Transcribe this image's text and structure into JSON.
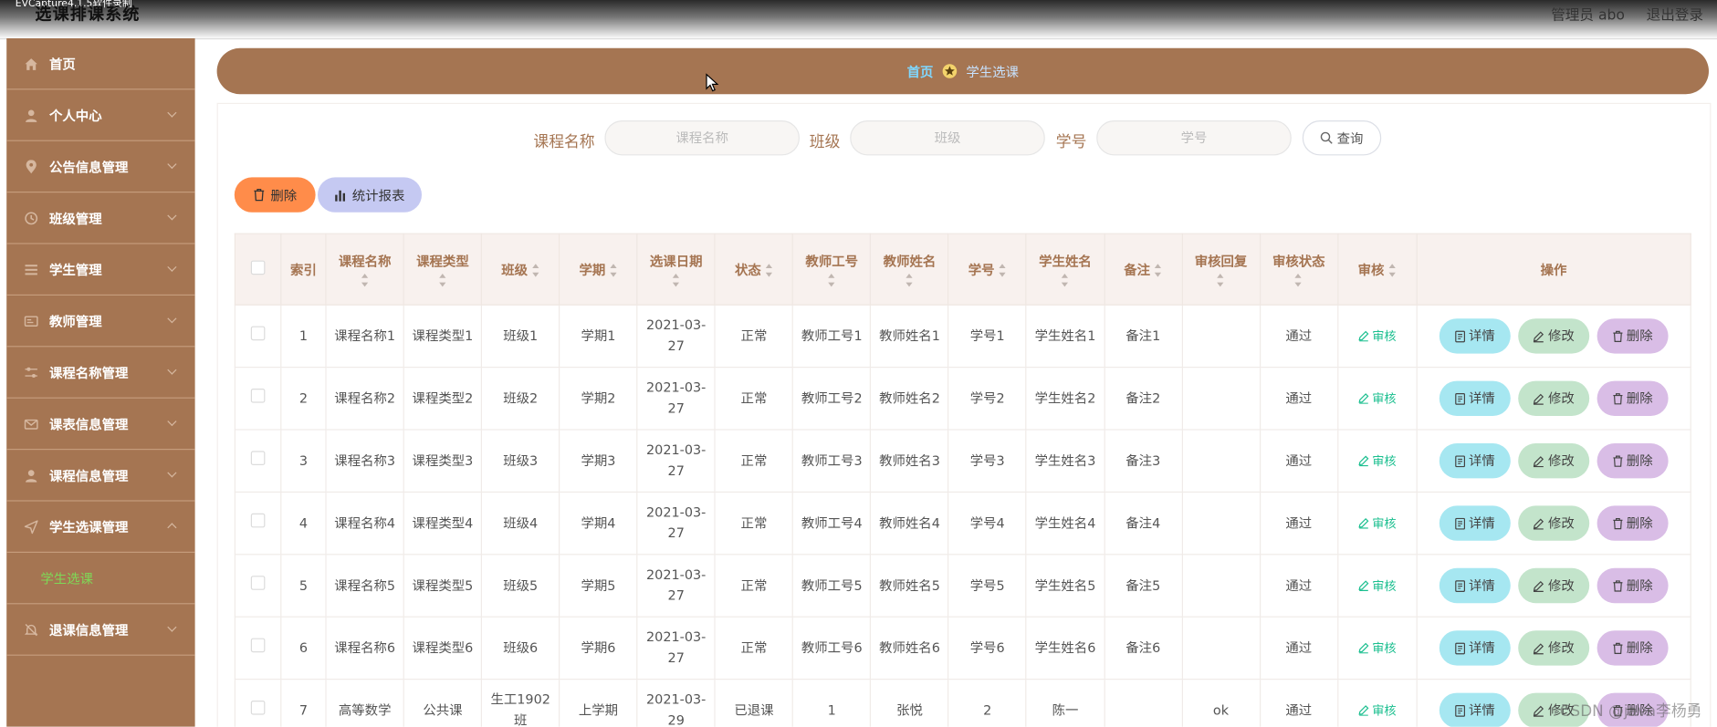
{
  "capture_label": "EVCapture4.1.5软件录制",
  "app": {
    "title": "选课排课系统",
    "admin": "管理员 abo",
    "logout": "退出登录"
  },
  "sidebar": {
    "items": [
      {
        "label": "首页",
        "icon": "home-icon",
        "expandable": false
      },
      {
        "label": "个人中心",
        "icon": "user-icon",
        "expandable": true
      },
      {
        "label": "公告信息管理",
        "icon": "location-icon",
        "expandable": true
      },
      {
        "label": "班级管理",
        "icon": "clock-icon",
        "expandable": true
      },
      {
        "label": "学生管理",
        "icon": "list-icon",
        "expandable": true
      },
      {
        "label": "教师管理",
        "icon": "card-icon",
        "expandable": true
      },
      {
        "label": "课程名称管理",
        "icon": "sliders-icon",
        "expandable": true
      },
      {
        "label": "课表信息管理",
        "icon": "mail-icon",
        "expandable": true
      },
      {
        "label": "课程信息管理",
        "icon": "user-icon",
        "expandable": true
      },
      {
        "label": "学生选课管理",
        "icon": "send-icon",
        "expandable": true,
        "expanded": true
      },
      {
        "label": "退课信息管理",
        "icon": "bell-off-icon",
        "expandable": true
      }
    ],
    "subitem": "学生选课"
  },
  "breadcrumb": {
    "home": "首页",
    "current": "学生选课"
  },
  "search": {
    "course_label": "课程名称",
    "course_placeholder": "课程名称",
    "class_label": "班级",
    "class_placeholder": "班级",
    "student_label": "学号",
    "student_placeholder": "学号",
    "query": "查询"
  },
  "toolbar": {
    "delete": "删除",
    "report": "统计报表"
  },
  "table": {
    "headers": [
      "索引",
      "课程名称",
      "课程类型",
      "班级",
      "学期",
      "选课日期",
      "状态",
      "教师工号",
      "教师姓名",
      "学号",
      "学生姓名",
      "备注",
      "审核回复",
      "审核状态",
      "审核",
      "操作"
    ],
    "rows": [
      [
        "1",
        "课程名称1",
        "课程类型1",
        "班级1",
        "学期1",
        "2021-03-27",
        "正常",
        "教师工号1",
        "教师姓名1",
        "学号1",
        "学生姓名1",
        "备注1",
        "",
        "通过"
      ],
      [
        "2",
        "课程名称2",
        "课程类型2",
        "班级2",
        "学期2",
        "2021-03-27",
        "正常",
        "教师工号2",
        "教师姓名2",
        "学号2",
        "学生姓名2",
        "备注2",
        "",
        "通过"
      ],
      [
        "3",
        "课程名称3",
        "课程类型3",
        "班级3",
        "学期3",
        "2021-03-27",
        "正常",
        "教师工号3",
        "教师姓名3",
        "学号3",
        "学生姓名3",
        "备注3",
        "",
        "通过"
      ],
      [
        "4",
        "课程名称4",
        "课程类型4",
        "班级4",
        "学期4",
        "2021-03-27",
        "正常",
        "教师工号4",
        "教师姓名4",
        "学号4",
        "学生姓名4",
        "备注4",
        "",
        "通过"
      ],
      [
        "5",
        "课程名称5",
        "课程类型5",
        "班级5",
        "学期5",
        "2021-03-27",
        "正常",
        "教师工号5",
        "教师姓名5",
        "学号5",
        "学生姓名5",
        "备注5",
        "",
        "通过"
      ],
      [
        "6",
        "课程名称6",
        "课程类型6",
        "班级6",
        "学期6",
        "2021-03-27",
        "正常",
        "教师工号6",
        "教师姓名6",
        "学号6",
        "学生姓名6",
        "备注6",
        "",
        "通过"
      ],
      [
        "7",
        "高等数学",
        "公共课",
        "生工1902班",
        "上学期",
        "2021-03-29",
        "已退课",
        "1",
        "张悦",
        "2",
        "陈一",
        "",
        "ok",
        "通过"
      ]
    ],
    "audit_label": "审核",
    "actions": {
      "detail": "详情",
      "edit": "修改",
      "delete": "删除"
    }
  },
  "watermark": "CSDN @java李杨勇",
  "colors": {
    "sidebar": "#a57552",
    "breadcrumb": "#a57552",
    "delete_button": "#ff8c4a",
    "report_button": "#c5c9f2",
    "detail_button": "#a6e7f1",
    "edit_button": "#c3e4cb",
    "row_delete_button": "#d9bde6",
    "audit_link": "#1bbf8f",
    "active_subitem": "#7ed957"
  }
}
